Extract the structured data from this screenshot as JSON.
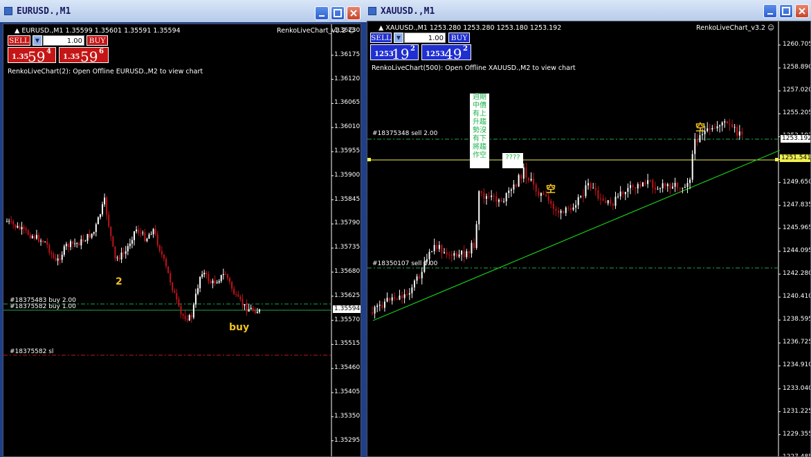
{
  "windows": [
    {
      "title": "EURUSD.,M1",
      "header": "EURUSD.,M1  1.35599 1.35601 1.35591 1.35594",
      "indicator": "RenkoLiveChart_v3.2",
      "indicator_message": "RenkoLiveChart(2): Open Offline EURUSD.,M2 to view chart",
      "trade_panel": {
        "sell_label": "SELL",
        "buy_label": "BUY",
        "lot_value": "1.00",
        "sell_small": "1.35",
        "sell_big": "59",
        "sell_sup": "4",
        "buy_small": "1.35",
        "buy_big": "59",
        "buy_sup": "6",
        "color": "#c41616"
      },
      "price_axis": [
        "1.36230",
        "1.36175",
        "1.36120",
        "1.36065",
        "1.36010",
        "1.35955",
        "1.35900",
        "1.35845",
        "1.35790",
        "1.35735",
        "1.35680",
        "1.35625",
        "1.35570",
        "1.35515",
        "1.35460",
        "1.35405",
        "1.35350",
        "1.35295"
      ],
      "current_price": "1.35594",
      "orders": [
        "#18375483 buy 2.00",
        "#18375582 buy 1.00",
        "#18375582 sl"
      ],
      "notes": [
        "2",
        "buy"
      ]
    },
    {
      "title": "XAUUSD.,M1",
      "header": "XAUUSD.,M1  1253.280 1253.280 1253.180 1253.192",
      "indicator": "RenkoLiveChart_v3.2",
      "indicator_message": "RenkoLiveChart(500): Open Offline XAUUSD.,M2 to view chart",
      "trade_panel": {
        "sell_label": "SELL",
        "buy_label": "BUY",
        "lot_value": "1.00",
        "sell_small": "1253",
        "sell_big": "19",
        "sell_sup": "2",
        "buy_small": "1253",
        "buy_big": "49",
        "buy_sup": "2",
        "color": "#1f2fd0"
      },
      "price_axis": [
        "1260.705",
        "1258.890",
        "1257.020",
        "1255.205",
        "1253.192",
        "1251.541",
        "1249.650",
        "1247.835",
        "1245.965",
        "1244.095",
        "1242.280",
        "1240.410",
        "1238.595",
        "1236.725",
        "1234.910",
        "1233.040",
        "1231.225",
        "1229.355",
        "1227.485"
      ],
      "current_price": "1253.192",
      "line_price": "1251.541",
      "orders": [
        "#18375348 sell 2.00",
        "#18350107 sell 1.00"
      ],
      "notes": [
        "空",
        "空",
        "????"
      ],
      "cjk_note": "週期中價有上升趨勢沒有下將趨作空"
    }
  ],
  "colors": {
    "bull": "#ffffff",
    "bear": "#c0141a",
    "trendline": "#18c818",
    "order_line": "#1fa94a",
    "sl_line": "#c81a1a",
    "yellow_line": "#f0f050"
  }
}
